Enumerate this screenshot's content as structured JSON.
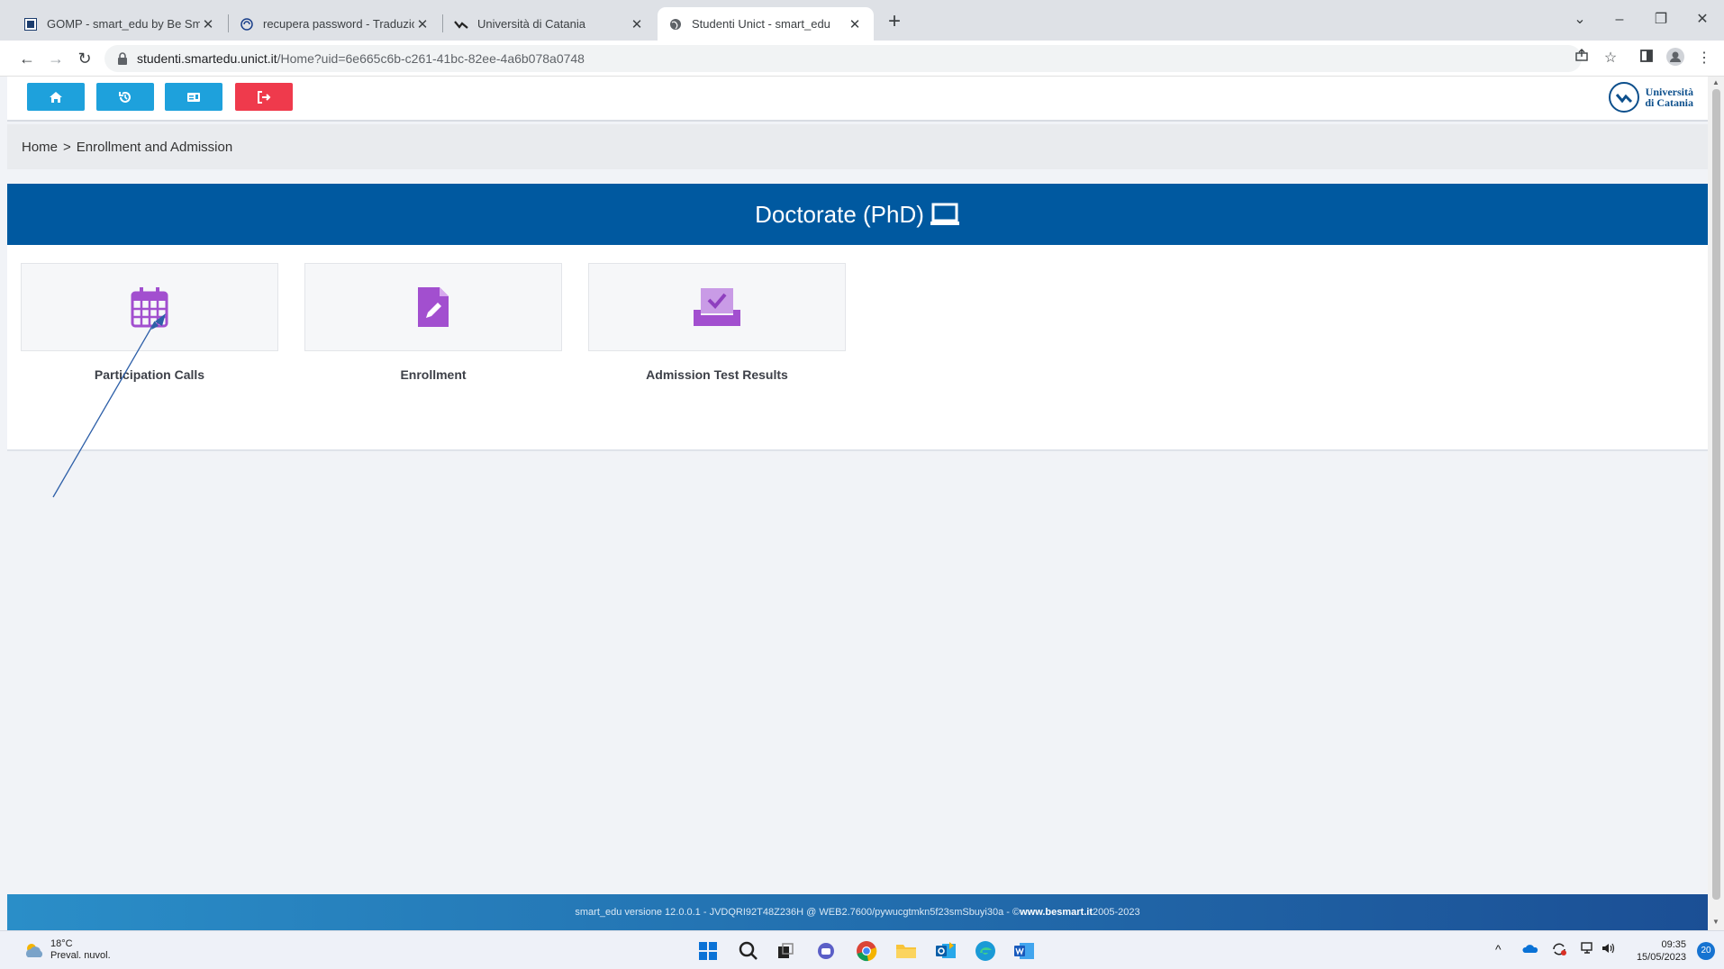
{
  "browser": {
    "tabs": [
      {
        "title": "GOMP - smart_edu by Be Smart",
        "favicon": "gomp-icon"
      },
      {
        "title": "recupera password - Traduzione",
        "favicon": "reverso-icon"
      },
      {
        "title": "Università di Catania",
        "favicon": "unict-icon"
      },
      {
        "title": "Studenti Unict - smart_edu",
        "favicon": "globe-icon",
        "active": true
      }
    ],
    "new_tab": "+",
    "window_controls": [
      "⌄",
      "–",
      "❐",
      "✕"
    ],
    "url_host": "studenti.smartedu.unict.it",
    "url_path": "/Home?uid=6e665c6b-c261-41bc-82ee-4a6b078a0748",
    "nav": [
      "←",
      "→",
      "↻"
    ],
    "toolbar_icons": [
      "share-icon",
      "star-icon",
      "sidebar-icon",
      "profile-icon",
      "menu-icon"
    ]
  },
  "header": {
    "buttons": [
      "home-icon",
      "history-icon",
      "id-card-icon",
      "logout-icon"
    ],
    "logo_line1": "Università",
    "logo_line2": "di Catania",
    "colors": {
      "button": "#1ea1dc",
      "logout": "#ef3a4c"
    }
  },
  "breadcrumb": {
    "home": "Home",
    "separator": ">",
    "current": "Enrollment and Admission"
  },
  "section": {
    "title": "Doctorate (PhD)",
    "title_icon": "laptop-icon",
    "banner_color": "#0059a0",
    "cards": [
      {
        "label": "Participation Calls",
        "icon": "calendar-icon"
      },
      {
        "label": "Enrollment",
        "icon": "document-edit-icon"
      },
      {
        "label": "Admission Test Results",
        "icon": "ballot-check-icon"
      }
    ],
    "icon_color": "#a24fcf"
  },
  "footer": {
    "text": "smart_edu versione 12.0.0.1 - JVDQRI92T48Z236H @ WEB2.7600/pywucgtmkn5f23smSbuyi30a - © ",
    "link": "www.besmart.it",
    "years": " 2005-2023"
  },
  "taskbar": {
    "temperature": "18°C",
    "weather": "Preval. nuvol.",
    "time": "09:35",
    "date": "15/05/2023",
    "notifications": "20",
    "apps": [
      "windows-start-icon",
      "search-icon",
      "task-view-icon",
      "teams-chat-icon",
      "chrome-icon",
      "file-explorer-icon",
      "outlook-icon",
      "edge-icon",
      "word-icon"
    ]
  }
}
